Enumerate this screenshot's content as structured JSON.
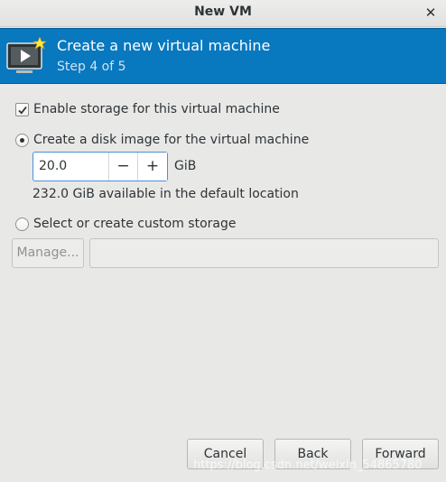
{
  "window": {
    "title": "New VM"
  },
  "header": {
    "title": "Create a new virtual machine",
    "step": "Step 4 of 5",
    "color": "#0878bf"
  },
  "storage": {
    "enable_label": "Enable storage for this virtual machine",
    "enable_checked": true,
    "disk_option_label": "Create a disk image for the virtual machine",
    "disk_option_selected": true,
    "size_value": "20.0",
    "size_unit": "GiB",
    "available_text": "232.0 GiB available in the default location",
    "custom_option_label": "Select or create custom storage",
    "custom_option_selected": false,
    "manage_label": "Manage...",
    "path_value": ""
  },
  "footer": {
    "cancel_label": "Cancel",
    "back_label": "Back",
    "forward_label": "Forward"
  },
  "watermark": "https://blog.csdn.net/weixin_54865780"
}
